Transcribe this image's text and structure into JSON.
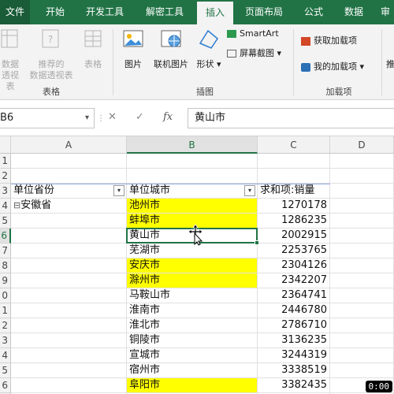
{
  "tabs": [
    "文件",
    "开始",
    "开发工具",
    "解密工具",
    "插入",
    "页面布局",
    "公式",
    "数据",
    "审"
  ],
  "ribbon": {
    "pivot_label_1": "数据",
    "pivot_label_2": "透视表",
    "recommended_pivot_1": "推荐的",
    "recommended_pivot_2": "数据透视表",
    "table_label": "表格",
    "group_tables": "表格",
    "picture_label": "图片",
    "online_picture_label": "联机图片",
    "shapes_label": "形状",
    "smartart_label": "SmartArt",
    "screenshot_label": "屏幕截图",
    "group_illustrations": "插图",
    "get_addins_label": "获取加载项",
    "my_addins_label": "我的加载项",
    "group_addins": "加载项",
    "partial_right": "推"
  },
  "formula_bar": {
    "name_box": "B6",
    "fx_label": "fx",
    "formula_value": "黄山市"
  },
  "grid": {
    "columns": [
      "A",
      "B",
      "C",
      "D"
    ],
    "row_numbers": [
      "1",
      "2",
      "3",
      "4",
      "5",
      "6",
      "7",
      "8",
      "9",
      "0",
      "1",
      "2",
      "3",
      "4",
      "5",
      "6",
      "7"
    ],
    "header_province": "单位省份",
    "header_city": "单位城市",
    "header_sum": "求和项:销量",
    "province": "安徽省",
    "expand_symbol": "⊟",
    "rows": [
      {
        "city": "池州市",
        "value": "1270178",
        "highlight": true
      },
      {
        "city": "蚌埠市",
        "value": "1286235",
        "highlight": true
      },
      {
        "city": "黄山市",
        "value": "2002915",
        "highlight": false
      },
      {
        "city": "芜湖市",
        "value": "2253765",
        "highlight": false
      },
      {
        "city": "安庆市",
        "value": "2304126",
        "highlight": true
      },
      {
        "city": "滁州市",
        "value": "2342207",
        "highlight": true
      },
      {
        "city": "马鞍山市",
        "value": "2364741",
        "highlight": false
      },
      {
        "city": "淮南市",
        "value": "2446780",
        "highlight": false
      },
      {
        "city": "淮北市",
        "value": "2786710",
        "highlight": false
      },
      {
        "city": "铜陵市",
        "value": "3136235",
        "highlight": false
      },
      {
        "city": "宣城市",
        "value": "3244319",
        "highlight": false
      },
      {
        "city": "宿州市",
        "value": "3338519",
        "highlight": false
      },
      {
        "city": "阜阳市",
        "value": "3382435",
        "highlight": true
      }
    ]
  },
  "timer": "0:00",
  "colors": {
    "excel_green": "#217346",
    "highlight_yellow": "#ffff00"
  }
}
